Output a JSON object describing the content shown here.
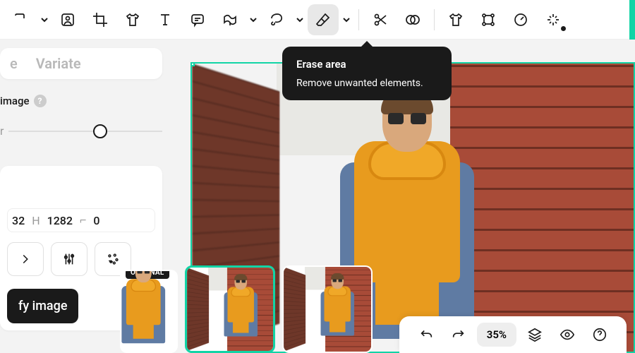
{
  "tooltip": {
    "title": "Erase area",
    "desc": "Remove unwanted elements."
  },
  "sidebar": {
    "tab_variate": "Variate",
    "image_label": "image",
    "dims": {
      "w_label": "32",
      "h_label": "H",
      "h_value": "1282",
      "r_label": "⌐",
      "r_value": "0"
    },
    "action_label": "fy image"
  },
  "thumbs": {
    "original_label": "ORIGINAL"
  },
  "bottombar": {
    "zoom": "35%"
  },
  "sidebar_prefix": "e"
}
